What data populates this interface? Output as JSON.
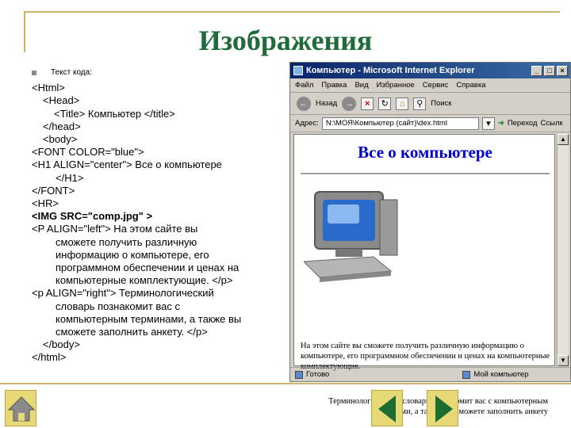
{
  "slide": {
    "title": "Изображения",
    "bullet_label": "Текст кода:"
  },
  "code_lines": [
    "<Html>",
    "<Head>",
    "<Title> Компьютер </title>",
    "</head>",
    "<body>",
    "<FONT COLOR=\"blue\">",
    "<H1 ALIGN=\"center\"> Все о компьютере",
    "</H1>",
    "</FONT>",
    "<HR>",
    "<IMG SRC=\"comp.jpg\" >",
    "<P ALIGN=\"left\"> На этом сайте вы",
    "сможете получить различную",
    "информацию о компьютере, его",
    "программном обеспечении и ценах на",
    "компьютерные комплектующие. </p>",
    "<p ALIGN=\"right\"> Терминологический",
    "словарь познакомит вас с",
    "компьютерным терминами, а также вы",
    "сможете заполнить анкету. </p>",
    "</body>",
    "</html>"
  ],
  "browser": {
    "window_title": "Компьютер - Microsoft Internet Explorer",
    "menu": [
      "Файл",
      "Правка",
      "Вид",
      "Избранное",
      "Сервис",
      "Справка"
    ],
    "back_label": "Назад",
    "search_label": "Поиск",
    "address_label": "Адрес:",
    "address_value": "N:\\МОЯ\\Компьютер (сайт)\\dex.html",
    "go_label": "Переход",
    "links_label": "Ссылк",
    "status_left": "Готово",
    "status_zone": "Мой компьютер",
    "page": {
      "heading": "Все о компьютере",
      "para_left": "На этом сайте вы сможете получить различную информацию о компьютере, его программном обеспечении и ценах на компьютерные комплектующие.",
      "para_right": "Терминологический словарь познакомит вас с компьютерным терминами, а также вы сможете заполнить анкету"
    }
  },
  "icons": {
    "home": "home-icon",
    "prev": "arrow-left-icon",
    "next": "arrow-right-icon",
    "colors": {
      "title": "#1f6b3a",
      "heading": "#0000cc",
      "nav_bg": "#e7d878",
      "nav_arrow": "#1b6e30"
    }
  }
}
